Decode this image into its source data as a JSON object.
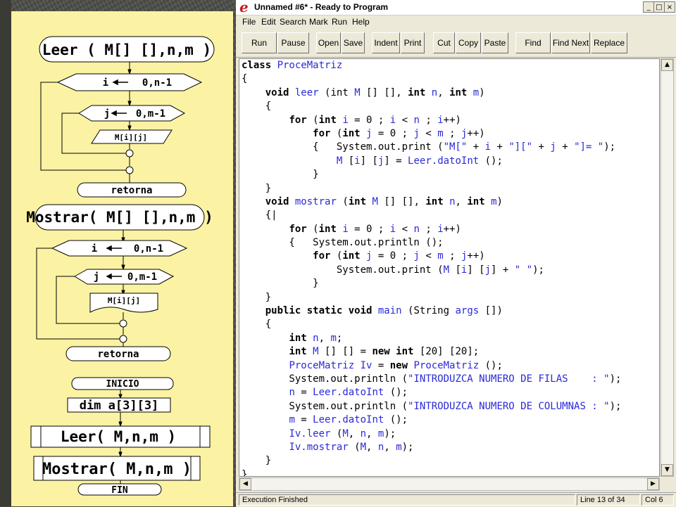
{
  "flowchart": {
    "leer_header": "Leer ( M[] [],n,m )",
    "leer_loop_i": {
      "var": "i",
      "range": "0,n-1"
    },
    "leer_loop_j": {
      "var": "j",
      "range": "0,m-1"
    },
    "leer_input": "M[i][j]",
    "leer_return": "retorna",
    "mostrar_header": "Mostrar( M[] [],n,m )",
    "mostrar_loop_i": {
      "var": "i",
      "range": "0,n-1"
    },
    "mostrar_loop_j": {
      "var": "j",
      "range": "0,m-1"
    },
    "mostrar_output": "M[i][j]",
    "mostrar_return": "retorna",
    "start": "INICIO",
    "dim": "dim a[3][3]",
    "call_leer": "Leer( M,n,m )",
    "call_mostrar": "Mostrar( M,n,m )",
    "end": "FIN"
  },
  "window": {
    "title": "Unnamed #6* - Ready to Program",
    "menus": [
      "File",
      "Edit",
      "Search",
      "Mark",
      "Run",
      "Help"
    ],
    "toolbar": [
      "Run",
      "Pause",
      "Open",
      "Save",
      "Indent",
      "Print",
      "Cut",
      "Copy",
      "Paste",
      "Find",
      "Find Next",
      "Replace"
    ],
    "controls": {
      "minimize": "_",
      "maximize": "□",
      "close": "×"
    }
  },
  "code_lines": [
    [
      [
        "kw",
        "class "
      ],
      [
        "id",
        "ProceMatriz"
      ]
    ],
    [
      [
        "",
        "{"
      ]
    ],
    [
      [
        "",
        "    "
      ],
      [
        "kw",
        "void "
      ],
      [
        "id",
        "leer "
      ],
      [
        "",
        "(int "
      ],
      [
        "id",
        "M"
      ],
      [
        "",
        " [] [], "
      ],
      [
        "kw",
        "int "
      ],
      [
        "id",
        "n"
      ],
      [
        "",
        ", "
      ],
      [
        "kw",
        "int "
      ],
      [
        "id",
        "m"
      ],
      [
        "",
        ")"
      ]
    ],
    [
      [
        "",
        "    {"
      ]
    ],
    [
      [
        "",
        "        "
      ],
      [
        "kw",
        "for "
      ],
      [
        "",
        "("
      ],
      [
        "kw",
        "int "
      ],
      [
        "id",
        "i"
      ],
      [
        "",
        " = 0 ; "
      ],
      [
        "id",
        "i"
      ],
      [
        "",
        " < "
      ],
      [
        "id",
        "n"
      ],
      [
        "",
        " ; "
      ],
      [
        "id",
        "i"
      ],
      [
        "",
        "++)"
      ]
    ],
    [
      [
        "",
        "            "
      ],
      [
        "kw",
        "for "
      ],
      [
        "",
        "("
      ],
      [
        "kw",
        "int "
      ],
      [
        "id",
        "j"
      ],
      [
        "",
        " = 0 ; "
      ],
      [
        "id",
        "j"
      ],
      [
        "",
        " < "
      ],
      [
        "id",
        "m"
      ],
      [
        "",
        " ; "
      ],
      [
        "id",
        "j"
      ],
      [
        "",
        "++)"
      ]
    ],
    [
      [
        "",
        "            {   System.out.print ("
      ],
      [
        "str",
        "\"M[\""
      ],
      [
        "",
        " + "
      ],
      [
        "id",
        "i"
      ],
      [
        "",
        " + "
      ],
      [
        "str",
        "\"][\""
      ],
      [
        "",
        " + "
      ],
      [
        "id",
        "j"
      ],
      [
        "",
        " + "
      ],
      [
        "str",
        "\"]= \""
      ],
      [
        "",
        ");"
      ]
    ],
    [
      [
        "",
        "                "
      ],
      [
        "id",
        "M"
      ],
      [
        "",
        " ["
      ],
      [
        "id",
        "i"
      ],
      [
        "",
        "] ["
      ],
      [
        "id",
        "j"
      ],
      [
        "",
        "] = "
      ],
      [
        "id",
        "Leer.datoInt"
      ],
      [
        "",
        " ();"
      ]
    ],
    [
      [
        "",
        "            }"
      ]
    ],
    [
      [
        "",
        "    }"
      ]
    ],
    [
      [
        "",
        "    "
      ],
      [
        "kw",
        "void "
      ],
      [
        "id",
        "mostrar "
      ],
      [
        "",
        "("
      ],
      [
        "kw",
        "int "
      ],
      [
        "id",
        "M"
      ],
      [
        "",
        " [] [], "
      ],
      [
        "kw",
        "int "
      ],
      [
        "id",
        "n"
      ],
      [
        "",
        ", "
      ],
      [
        "kw",
        "int "
      ],
      [
        "id",
        "m"
      ],
      [
        "",
        ")"
      ]
    ],
    [
      [
        "",
        "    {|"
      ]
    ],
    [
      [
        "",
        "        "
      ],
      [
        "kw",
        "for "
      ],
      [
        "",
        "("
      ],
      [
        "kw",
        "int "
      ],
      [
        "id",
        "i"
      ],
      [
        "",
        " = 0 ; "
      ],
      [
        "id",
        "i"
      ],
      [
        "",
        " < "
      ],
      [
        "id",
        "n"
      ],
      [
        "",
        " ; "
      ],
      [
        "id",
        "i"
      ],
      [
        "",
        "++)"
      ]
    ],
    [
      [
        "",
        "        {   System.out.println ();"
      ]
    ],
    [
      [
        "",
        "            "
      ],
      [
        "kw",
        "for "
      ],
      [
        "",
        "("
      ],
      [
        "kw",
        "int "
      ],
      [
        "id",
        "j"
      ],
      [
        "",
        " = 0 ; "
      ],
      [
        "id",
        "j"
      ],
      [
        "",
        " < "
      ],
      [
        "id",
        "m"
      ],
      [
        "",
        " ; "
      ],
      [
        "id",
        "j"
      ],
      [
        "",
        "++)"
      ]
    ],
    [
      [
        "",
        "                System.out.print ("
      ],
      [
        "id",
        "M"
      ],
      [
        "",
        " ["
      ],
      [
        "id",
        "i"
      ],
      [
        "",
        "] ["
      ],
      [
        "id",
        "j"
      ],
      [
        "",
        "] + "
      ],
      [
        "str",
        "\" \""
      ],
      [
        "",
        ");"
      ]
    ],
    [
      [
        "",
        "            }"
      ]
    ],
    [
      [
        "",
        "    }"
      ]
    ],
    [
      [
        "",
        "    "
      ],
      [
        "kw",
        "public static void "
      ],
      [
        "id",
        "main "
      ],
      [
        "",
        "(String "
      ],
      [
        "id",
        "args"
      ],
      [
        "",
        " [])"
      ]
    ],
    [
      [
        "",
        "    {"
      ]
    ],
    [
      [
        "",
        "        "
      ],
      [
        "kw",
        "int "
      ],
      [
        "id",
        "n"
      ],
      [
        "",
        ", "
      ],
      [
        "id",
        "m"
      ],
      [
        "",
        ";"
      ]
    ],
    [
      [
        "",
        "        "
      ],
      [
        "kw",
        "int "
      ],
      [
        "id",
        "M"
      ],
      [
        "",
        " [] [] = "
      ],
      [
        "kw",
        "new int "
      ],
      [
        "",
        "[20] [20];"
      ]
    ],
    [
      [
        "",
        "        "
      ],
      [
        "id",
        "ProceMatriz Iv"
      ],
      [
        "",
        " = "
      ],
      [
        "kw",
        "new "
      ],
      [
        "id",
        "ProceMatriz"
      ],
      [
        "",
        " ();"
      ]
    ],
    [
      [
        "",
        "        System.out.println ("
      ],
      [
        "str",
        "\"INTRODUZCA NUMERO DE FILAS    : \""
      ],
      [
        "",
        ");"
      ]
    ],
    [
      [
        "",
        "        "
      ],
      [
        "id",
        "n"
      ],
      [
        "",
        " = "
      ],
      [
        "id",
        "Leer.datoInt"
      ],
      [
        "",
        " ();"
      ]
    ],
    [
      [
        "",
        "        System.out.println ("
      ],
      [
        "str",
        "\"INTRODUZCA NUMERO DE COLUMNAS : \""
      ],
      [
        "",
        ");"
      ]
    ],
    [
      [
        "",
        "        "
      ],
      [
        "id",
        "m"
      ],
      [
        "",
        " = "
      ],
      [
        "id",
        "Leer.datoInt"
      ],
      [
        "",
        " ();"
      ]
    ],
    [
      [
        "",
        "        "
      ],
      [
        "id",
        "Iv.leer"
      ],
      [
        "",
        " ("
      ],
      [
        "id",
        "M"
      ],
      [
        "",
        ", "
      ],
      [
        "id",
        "n"
      ],
      [
        "",
        ", "
      ],
      [
        "id",
        "m"
      ],
      [
        "",
        ");"
      ]
    ],
    [
      [
        "",
        "        "
      ],
      [
        "id",
        "Iv.mostrar"
      ],
      [
        "",
        " ("
      ],
      [
        "id",
        "M"
      ],
      [
        "",
        ", "
      ],
      [
        "id",
        "n"
      ],
      [
        "",
        ", "
      ],
      [
        "id",
        "m"
      ],
      [
        "",
        ");"
      ]
    ],
    [
      [
        "",
        "    }"
      ]
    ],
    [
      [
        "",
        "}"
      ]
    ]
  ],
  "statusbar": {
    "message": "Execution Finished",
    "position": "Line 13 of 34",
    "column": "Col 6"
  }
}
